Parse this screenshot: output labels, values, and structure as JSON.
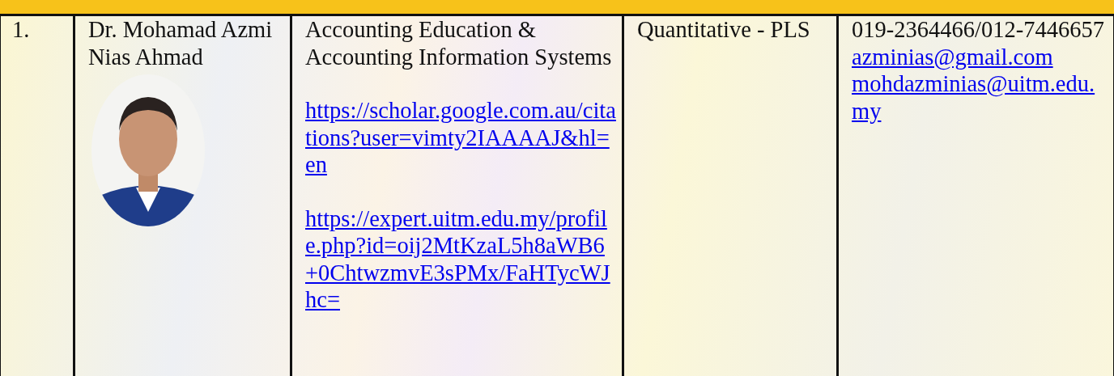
{
  "table": {
    "rows": [
      {
        "number": "1.",
        "name": "Dr. Mohamad Azmi Nias Ahmad",
        "field": "Accounting Education & Accounting Information Systems",
        "links": [
          "https://scholar.google.com.au/citations?user=vimty2IAAAAJ&hl=en",
          "https://expert.uitm.edu.my/profile.php?id=oij2MtKzaL5h8aWB6+0ChtwzmvE3sPMx/FaHTycWJhc="
        ],
        "method": "Quantitative - PLS",
        "phone": "019-2364466/012-7446657",
        "emails": [
          "azminias@gmail.com",
          "mohdazminias@uitm.edu.my"
        ]
      }
    ]
  }
}
